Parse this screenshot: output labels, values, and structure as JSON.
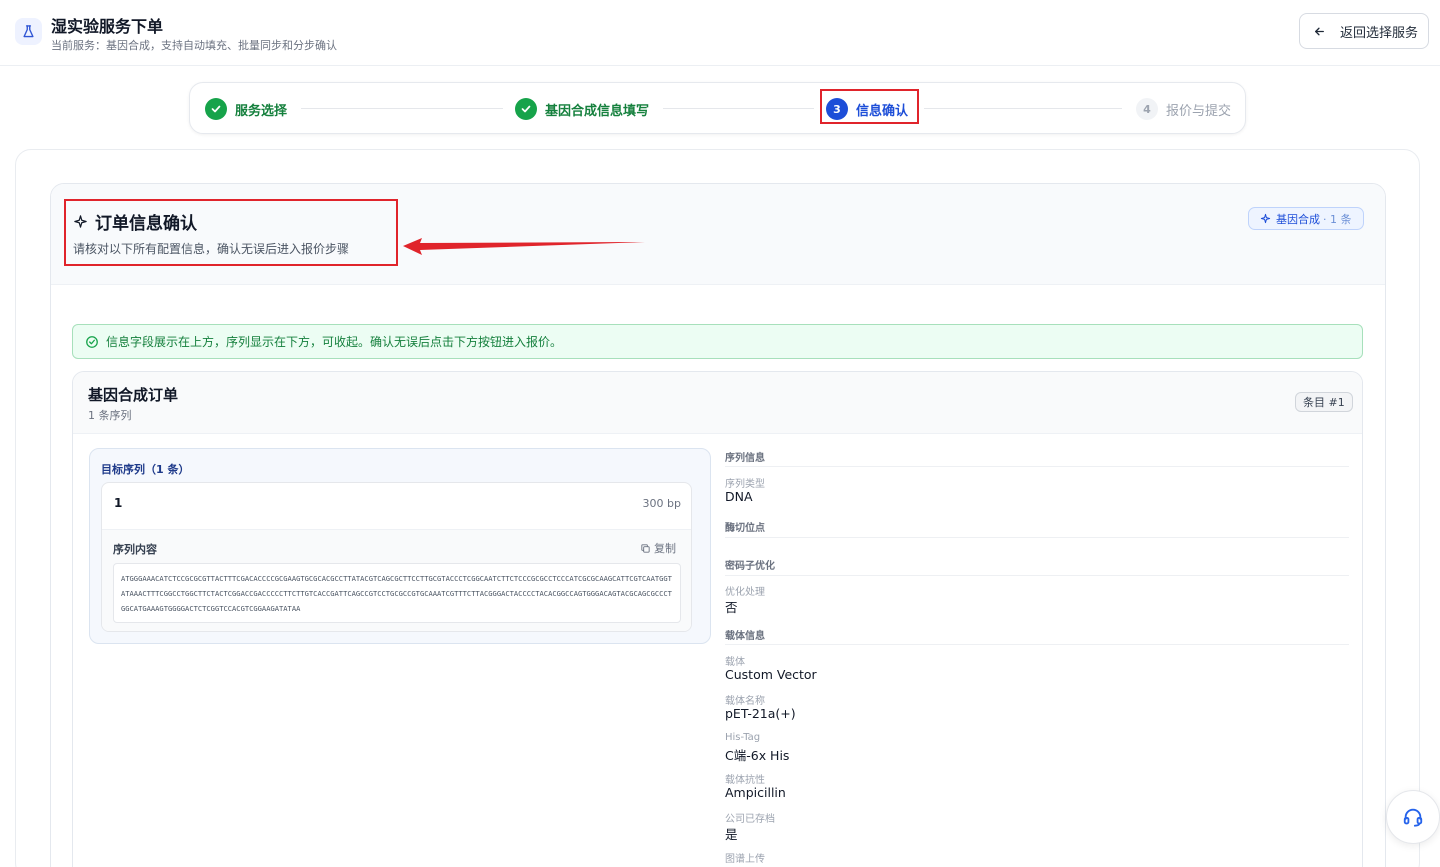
{
  "header": {
    "title": "湿实验服务下单",
    "subtitle": "当前服务：基因合成，支持自动填充、批量同步和分步确认",
    "back_label": "返回选择服务"
  },
  "stepper": {
    "steps": [
      {
        "index": "1",
        "label": "服务选择",
        "state": "done"
      },
      {
        "index": "2",
        "label": "基因合成信息填写",
        "state": "done"
      },
      {
        "index": "3",
        "label": "信息确认",
        "state": "active"
      },
      {
        "index": "4",
        "label": "报价与提交",
        "state": "pending"
      }
    ]
  },
  "confirm": {
    "title": "订单信息确认",
    "subtitle": "请核对以下所有配置信息，确认无误后进入报价步骤",
    "badge_service": "基因合成",
    "badge_count": "· 1 条"
  },
  "banner": {
    "text": "信息字段展示在上方，序列显示在下方，可收起。确认无误后点击下方按钮进入报价。"
  },
  "order": {
    "title": "基因合成订单",
    "count": "1 条序列",
    "item_badge": "条目 #1",
    "target_title": "目标序列（1 条）",
    "sequence": {
      "index": "1",
      "length": "300 bp",
      "content_label": "序列内容",
      "copy_label": "复制",
      "content": "ATGGGAAACATCTCCGCGCGTTACTTTCGACACCCCGCGAAGTGCGCACGCCTTATACGTCAGCGCTTCCTTGCGTACCCTCGGCAATCTTCTCCCGCGCCTCCCATCGCGCAAGCATTCGTCAATGGTATAAACTTTCGGCCTGGCTTCTACTCGGACCGACCCCCTTCTTGTCACCGATTCAGCCGTCCTGCGCCGTGCAAATCGTTTCTTACGGGACTACCCCTACACGGCCAGTGGGACAGTACGCAGCGCCCTGGCATGAAAGTGGGGACTCTCGGTCCACGTCGGAAGATATAA"
    },
    "info": {
      "seq_info_header": "序列信息",
      "seq_type_label": "序列类型",
      "seq_type_value": "DNA",
      "cut_site_label": "酶切位点",
      "codon_header": "密码子优化",
      "optimize_label": "优化处理",
      "optimize_value": "否",
      "vector_header": "载体信息",
      "vector_label": "载体",
      "vector_value": "Custom Vector",
      "vector_name_label": "载体名称",
      "vector_name_value": "pET-21a(+)",
      "his_tag_label": "His-Tag",
      "his_tag_value": "C端-6x His",
      "resistance_label": "载体抗性",
      "resistance_value": "Ampicillin",
      "stocked_label": "公司已存档",
      "stocked_value": "是",
      "map_upload_label": "图谱上传"
    }
  },
  "colors": {
    "primary": "#1d4ed8",
    "success": "#16a34a",
    "annotation": "#e0242b"
  },
  "icons": {
    "logo": "flask-icon",
    "back": "arrow-left-icon",
    "done": "check-icon",
    "title": "sparkle-icon",
    "banner": "check-circle-icon",
    "copy": "copy-icon",
    "support": "headset-icon"
  }
}
